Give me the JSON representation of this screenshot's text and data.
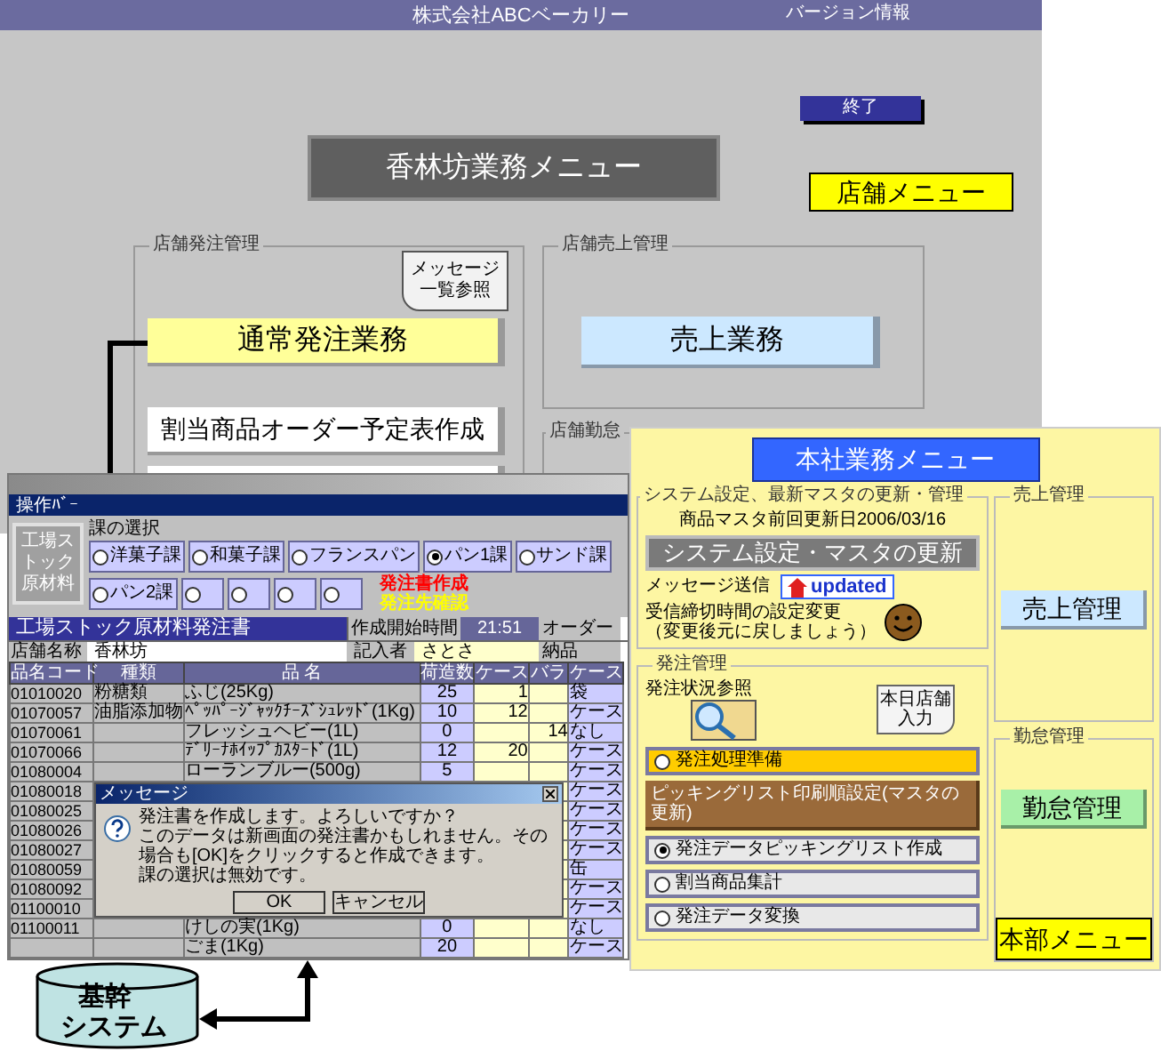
{
  "store_menu": {
    "title": "株式会社ABCベーカリー",
    "version_link": "バージョン情報",
    "exit_button": "終了",
    "header_button": "香林坊業務メニュー",
    "menu_label": "店舗メニュー",
    "order_group": {
      "title": "店舗発注管理",
      "message_note": [
        "メッセージ",
        "一覧参照"
      ],
      "buttons": [
        {
          "kind": "yellow",
          "label": "通常発注業務"
        },
        {
          "kind": "white",
          "label": "割当商品オーダー予定表作成"
        },
        {
          "kind": "white"
        }
      ]
    },
    "sales_group": {
      "title": "店舗売上管理",
      "button": "売上業務"
    },
    "attendance_group": {
      "title": "店舗勤怠"
    }
  },
  "order_window": {
    "toolbar_title": "操作ﾊﾞｰ",
    "factory_button": "工場ストック原材料",
    "section_label": "課の選択",
    "radios": [
      {
        "label": "洋菓子課",
        "selected": false
      },
      {
        "label": "和菓子課",
        "selected": false
      },
      {
        "label": "フランスパン",
        "selected": false
      },
      {
        "label": "パン1課",
        "selected": true
      },
      {
        "label": "サンド課",
        "selected": false
      },
      {
        "label": "パン2課",
        "selected": false
      },
      {
        "selected": false
      },
      {
        "selected": false
      },
      {
        "selected": false
      },
      {
        "selected": false
      }
    ],
    "actions": [
      {
        "label": "発注書作成",
        "color": "#ff0000"
      },
      {
        "label": "発注先確認",
        "color": "#ffff00"
      }
    ],
    "form": {
      "title": "工場ストック原材料発注書",
      "start_time_label": "作成開始時間",
      "start_time": "21:51",
      "order_date_label": "オーダー",
      "store_label": "店舗名称",
      "store": "香林坊",
      "writer_label": "記入者",
      "writer": "さとさ",
      "delivery_label": "納品",
      "columns": [
        "品名コード",
        "種類",
        "品 名",
        "荷造数",
        "ケース",
        "バラ",
        "ケース"
      ],
      "rows": [
        {
          "code": "01010020",
          "type": "粉糖類",
          "name": "ふじ(25Kg)",
          "qty": "25",
          "case": "1",
          "unit": "袋"
        },
        {
          "code": "01070057",
          "type": "油脂添加物",
          "name": "ﾍﾟｯﾊﾟｰｼﾞｬｯｸﾁｰｽﾞｼｭﾚｯﾄﾞ(1Kg)",
          "qty": "10",
          "case": "12",
          "unit": "ケース"
        },
        {
          "code": "01070061",
          "name": "フレッシュヘビー(1L)",
          "qty": "0",
          "loose": "14",
          "unit": "なし"
        },
        {
          "code": "01070066",
          "name": "ﾃﾞﾘｰﾅﾎｲｯﾌﾟｶｽﾀｰﾄﾞ(1L)",
          "qty": "12",
          "case": "20",
          "unit": "ケース"
        },
        {
          "code": "01080004",
          "name": "ローランブルー(500g)",
          "qty": "5",
          "unit": "ケース"
        },
        {
          "code": "01080018",
          "unit": "ケース"
        },
        {
          "code": "01080025",
          "unit": "ケース"
        },
        {
          "code": "01080026",
          "unit": "ケース"
        },
        {
          "code": "01080027",
          "unit": "ケース"
        },
        {
          "code": "01080059",
          "unit": "缶"
        },
        {
          "code": "01080092",
          "unit": "ケース"
        },
        {
          "code": "01100010",
          "unit": "ケース"
        },
        {
          "code": "01100011",
          "name": "けしの実(1Kg)",
          "qty": "0",
          "unit": "なし"
        },
        {
          "name": "ごま(1Kg)",
          "qty": "20",
          "unit": "ケース"
        }
      ]
    }
  },
  "dialog": {
    "title": "メッセージ",
    "lines": [
      "発注書を作成します。よろしいですか？",
      "このデータは新画面の発注書かもしれません。その場合も[OK]をクリックすると作成できます。",
      "課の選択は無効です。"
    ],
    "buttons": [
      "OK",
      "キャンセル"
    ]
  },
  "hq_menu": {
    "header_button": "本社業務メニュー",
    "system_group": {
      "title": "システム設定、最新マスタの更新・管理",
      "last_update": "商品マスタ前回更新日2006/03/16",
      "update_button": "システム設定・マスタの更新",
      "message_label": "メッセージ送信",
      "updated_badge": "updated",
      "deadline_lines": [
        "受信締切時間の設定変更",
        "（変更後元に戻しましょう）"
      ]
    },
    "sales_group": {
      "title": "売上管理",
      "button": "売上管理"
    },
    "order_group": {
      "title": "発注管理",
      "status_label": "発注状況参照",
      "store_input_note": [
        "本日店舗",
        "入力"
      ],
      "items": [
        {
          "kind": "radio",
          "label": "発注処理準備",
          "selected": false,
          "highlighted": true
        },
        {
          "kind": "button",
          "label": "ピッキングリスト印刷順設定(マスタの更新)"
        },
        {
          "kind": "radio",
          "label": "発注データピッキングリスト作成",
          "selected": true,
          "highlighted": false
        },
        {
          "kind": "radio",
          "label": "割当商品集計",
          "selected": false,
          "highlighted": false
        },
        {
          "kind": "radio",
          "label": "発注データ変換",
          "selected": false,
          "highlighted": false
        }
      ]
    },
    "attendance_group": {
      "title": "勤怠管理",
      "button": "勤怠管理"
    },
    "menu_label": "本部メニュー"
  },
  "core_system": {
    "lines": [
      "基幹",
      "システム"
    ]
  }
}
